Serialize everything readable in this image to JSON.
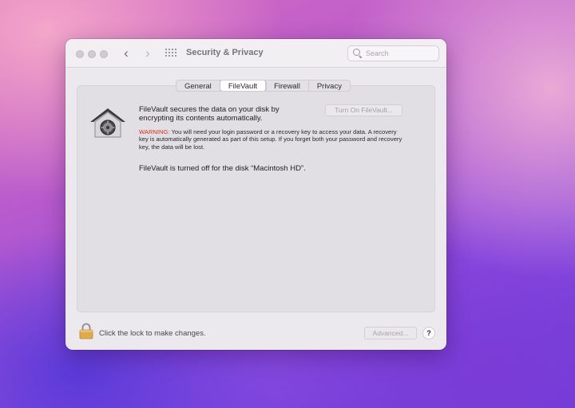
{
  "window": {
    "title": "Security & Privacy",
    "search_placeholder": "Search"
  },
  "icons": {
    "back": "chevron-left-icon",
    "forward": "chevron-right-icon",
    "grid": "grid-icon",
    "search": "search-icon",
    "filevault": "house-safe-icon",
    "lock": "padlock-icon"
  },
  "tabs": [
    {
      "label": "General",
      "active": false
    },
    {
      "label": "FileVault",
      "active": true
    },
    {
      "label": "Firewall",
      "active": false
    },
    {
      "label": "Privacy",
      "active": false
    }
  ],
  "filevault": {
    "intro": "FileVault secures the data on your disk by encrypting its contents automatically.",
    "turn_on_label": "Turn On FileVault...",
    "warning_label": "WARNING:",
    "warning_text": " You will need your login password or a recovery key to access your data. A recovery key is automatically generated as part of this setup. If you forget both your password and recovery key, the data will be lost.",
    "status": "FileVault is turned off for the disk “Macintosh HD”."
  },
  "footer": {
    "lock_label": "Click the lock to make changes.",
    "advanced_label": "Advanced...",
    "help_label": "?"
  },
  "colors": {
    "warning": "#d0311f",
    "window_bg": "#ece9ee",
    "lock": "#e0a94e"
  }
}
